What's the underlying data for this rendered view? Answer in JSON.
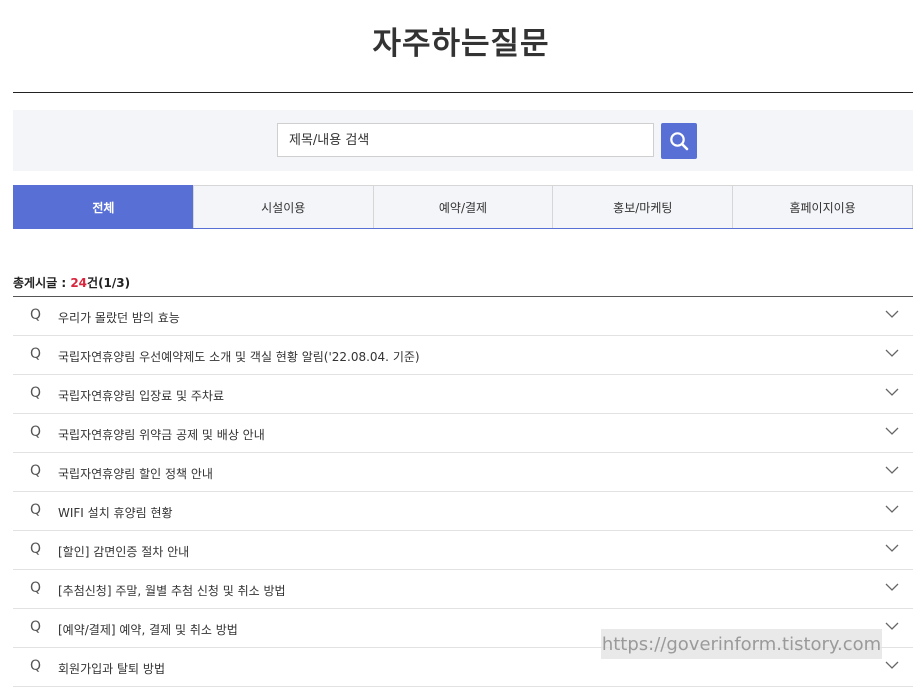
{
  "page_title": "자주하는질문",
  "search": {
    "placeholder": "제목/내용 검색",
    "value": "",
    "button_icon": "search-icon"
  },
  "tabs": [
    {
      "label": "전체",
      "active": true
    },
    {
      "label": "시설이용",
      "active": false
    },
    {
      "label": "예약/결제",
      "active": false
    },
    {
      "label": "홍보/마케팅",
      "active": false
    },
    {
      "label": "홈페이지이용",
      "active": false
    }
  ],
  "count": {
    "label": "총게시글 : ",
    "number": "24",
    "suffix": "건(1/3)"
  },
  "faq": {
    "q_marker": "Q",
    "items": [
      "우리가 몰랐던 밤의 효능",
      "국립자연휴양림 우선예약제도 소개 및 객실 현황 알림('22.08.04. 기준)",
      "국립자연휴양림 입장료 및 주차료",
      "국립자연휴양림 위약금 공제 및 배상 안내",
      "국립자연휴양림 할인 정책 안내",
      "WIFI 설치 휴양림 현황",
      "[할인] 감면인증 절차 안내",
      "[추첨신청] 주말, 월별 추첨 신청 및 취소 방법",
      "[예약/결제] 예약, 결제 및 취소 방법",
      "회원가입과 탈퇴 방법"
    ]
  },
  "watermark": "https://goverinform.tistory.com",
  "colors": {
    "accent": "#5870d6",
    "count_number": "#d7263d",
    "search_bg": "#f4f5f9"
  }
}
